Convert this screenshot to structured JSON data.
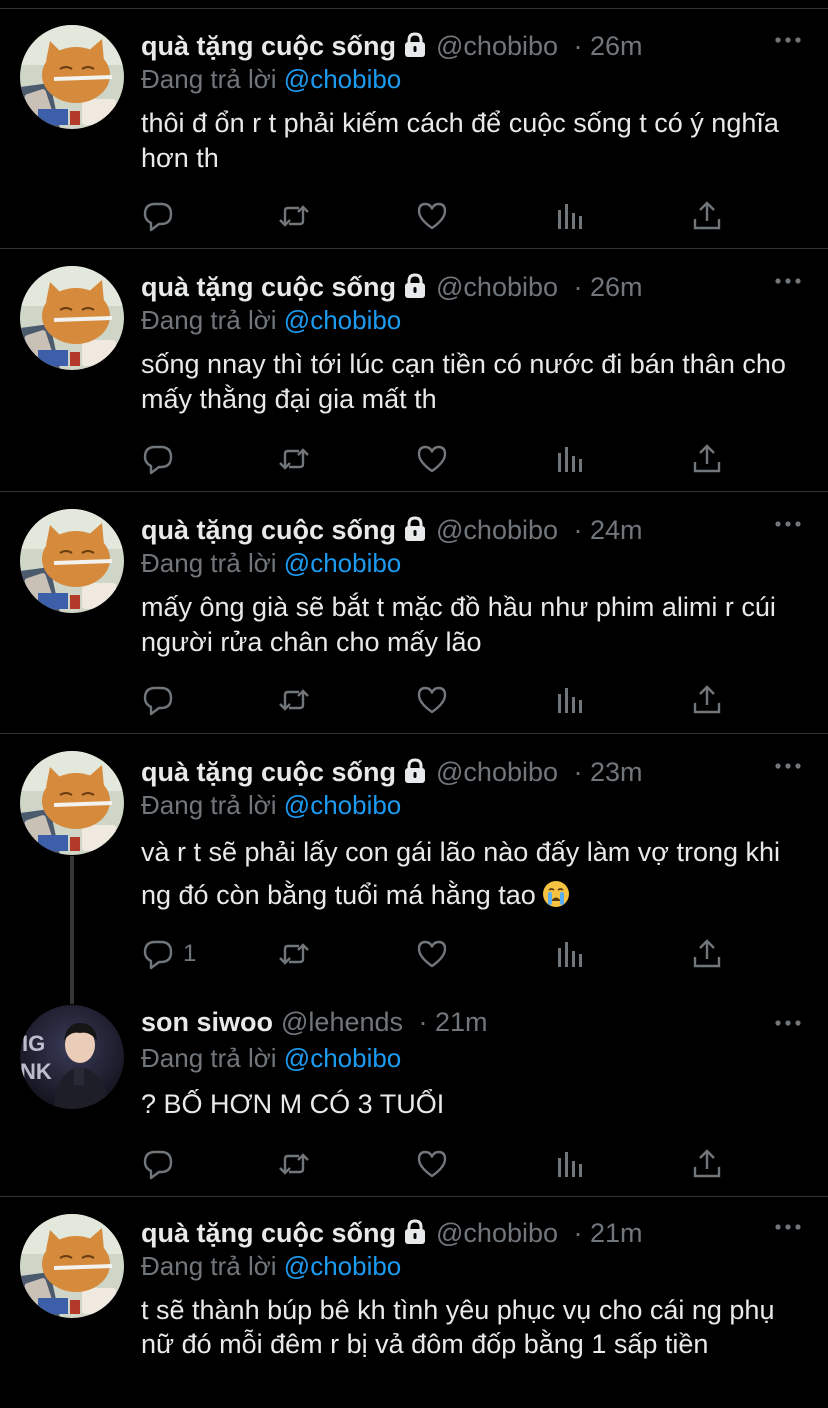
{
  "tweets": [
    {
      "name": "quà tặng cuộc sống",
      "handle": "@chobibo",
      "time": "26m",
      "replying_label": "Đang trả lời",
      "replying_to": "@chobibo",
      "text": "thôi đ ổn r t phải kiếm cách để cuộc sống t có ý nghĩa hơn th",
      "locked": true,
      "reply_count": ""
    },
    {
      "name": "quà tặng cuộc sống",
      "handle": "@chobibo",
      "time": "26m",
      "replying_label": "Đang trả lời",
      "replying_to": "@chobibo",
      "text": "sống nnay thì tới lúc cạn tiền có nước đi bán thân cho mấy thằng đại gia mất th",
      "locked": true,
      "reply_count": ""
    },
    {
      "name": "quà tặng cuộc sống",
      "handle": "@chobibo",
      "time": "24m",
      "replying_label": "Đang trả lời",
      "replying_to": "@chobibo",
      "text": "mấy ông già sẽ bắt t mặc đồ hầu như phim alimi r cúi người rửa chân cho mấy lão",
      "locked": true,
      "reply_count": ""
    },
    {
      "name": "quà tặng cuộc sống",
      "handle": "@chobibo",
      "time": "23m",
      "replying_label": "Đang trả lời",
      "replying_to": "@chobibo",
      "text": "và r t sẽ phải lấy con gái lão nào đấy làm vợ trong khi ng đó còn bằng tuổi má hằng tao",
      "emoji": "loudly-crying-face",
      "locked": true,
      "reply_count": "1"
    },
    {
      "name": "son siwoo",
      "handle": "@lehends",
      "time": "21m",
      "replying_label": "Đang trả lời",
      "replying_to": "@chobibo",
      "text": "? BỐ HƠN M CÓ 3 TUỔI",
      "locked": false,
      "reply_count": ""
    },
    {
      "name": "quà tặng cuộc sống",
      "handle": "@chobibo",
      "time": "21m",
      "replying_label": "Đang trả lời",
      "replying_to": "@chobibo",
      "text": "t sẽ thành búp bê kh tình yêu phục vụ cho cái ng phụ nữ đó mỗi đêm r bị vả đôm đốp bằng 1 sấp tiền",
      "locked": true,
      "reply_count": ""
    }
  ],
  "icons": {
    "reply": "comment-icon",
    "retweet": "retweet-icon",
    "like": "heart-icon",
    "views": "analytics-icon",
    "share": "share-icon",
    "more": "more-icon",
    "lock": "lock-icon"
  },
  "colors": {
    "background": "#000000",
    "text": "#e7e9ea",
    "muted": "#71767b",
    "accent": "#1d9bf0",
    "divider": "#2f3336"
  }
}
